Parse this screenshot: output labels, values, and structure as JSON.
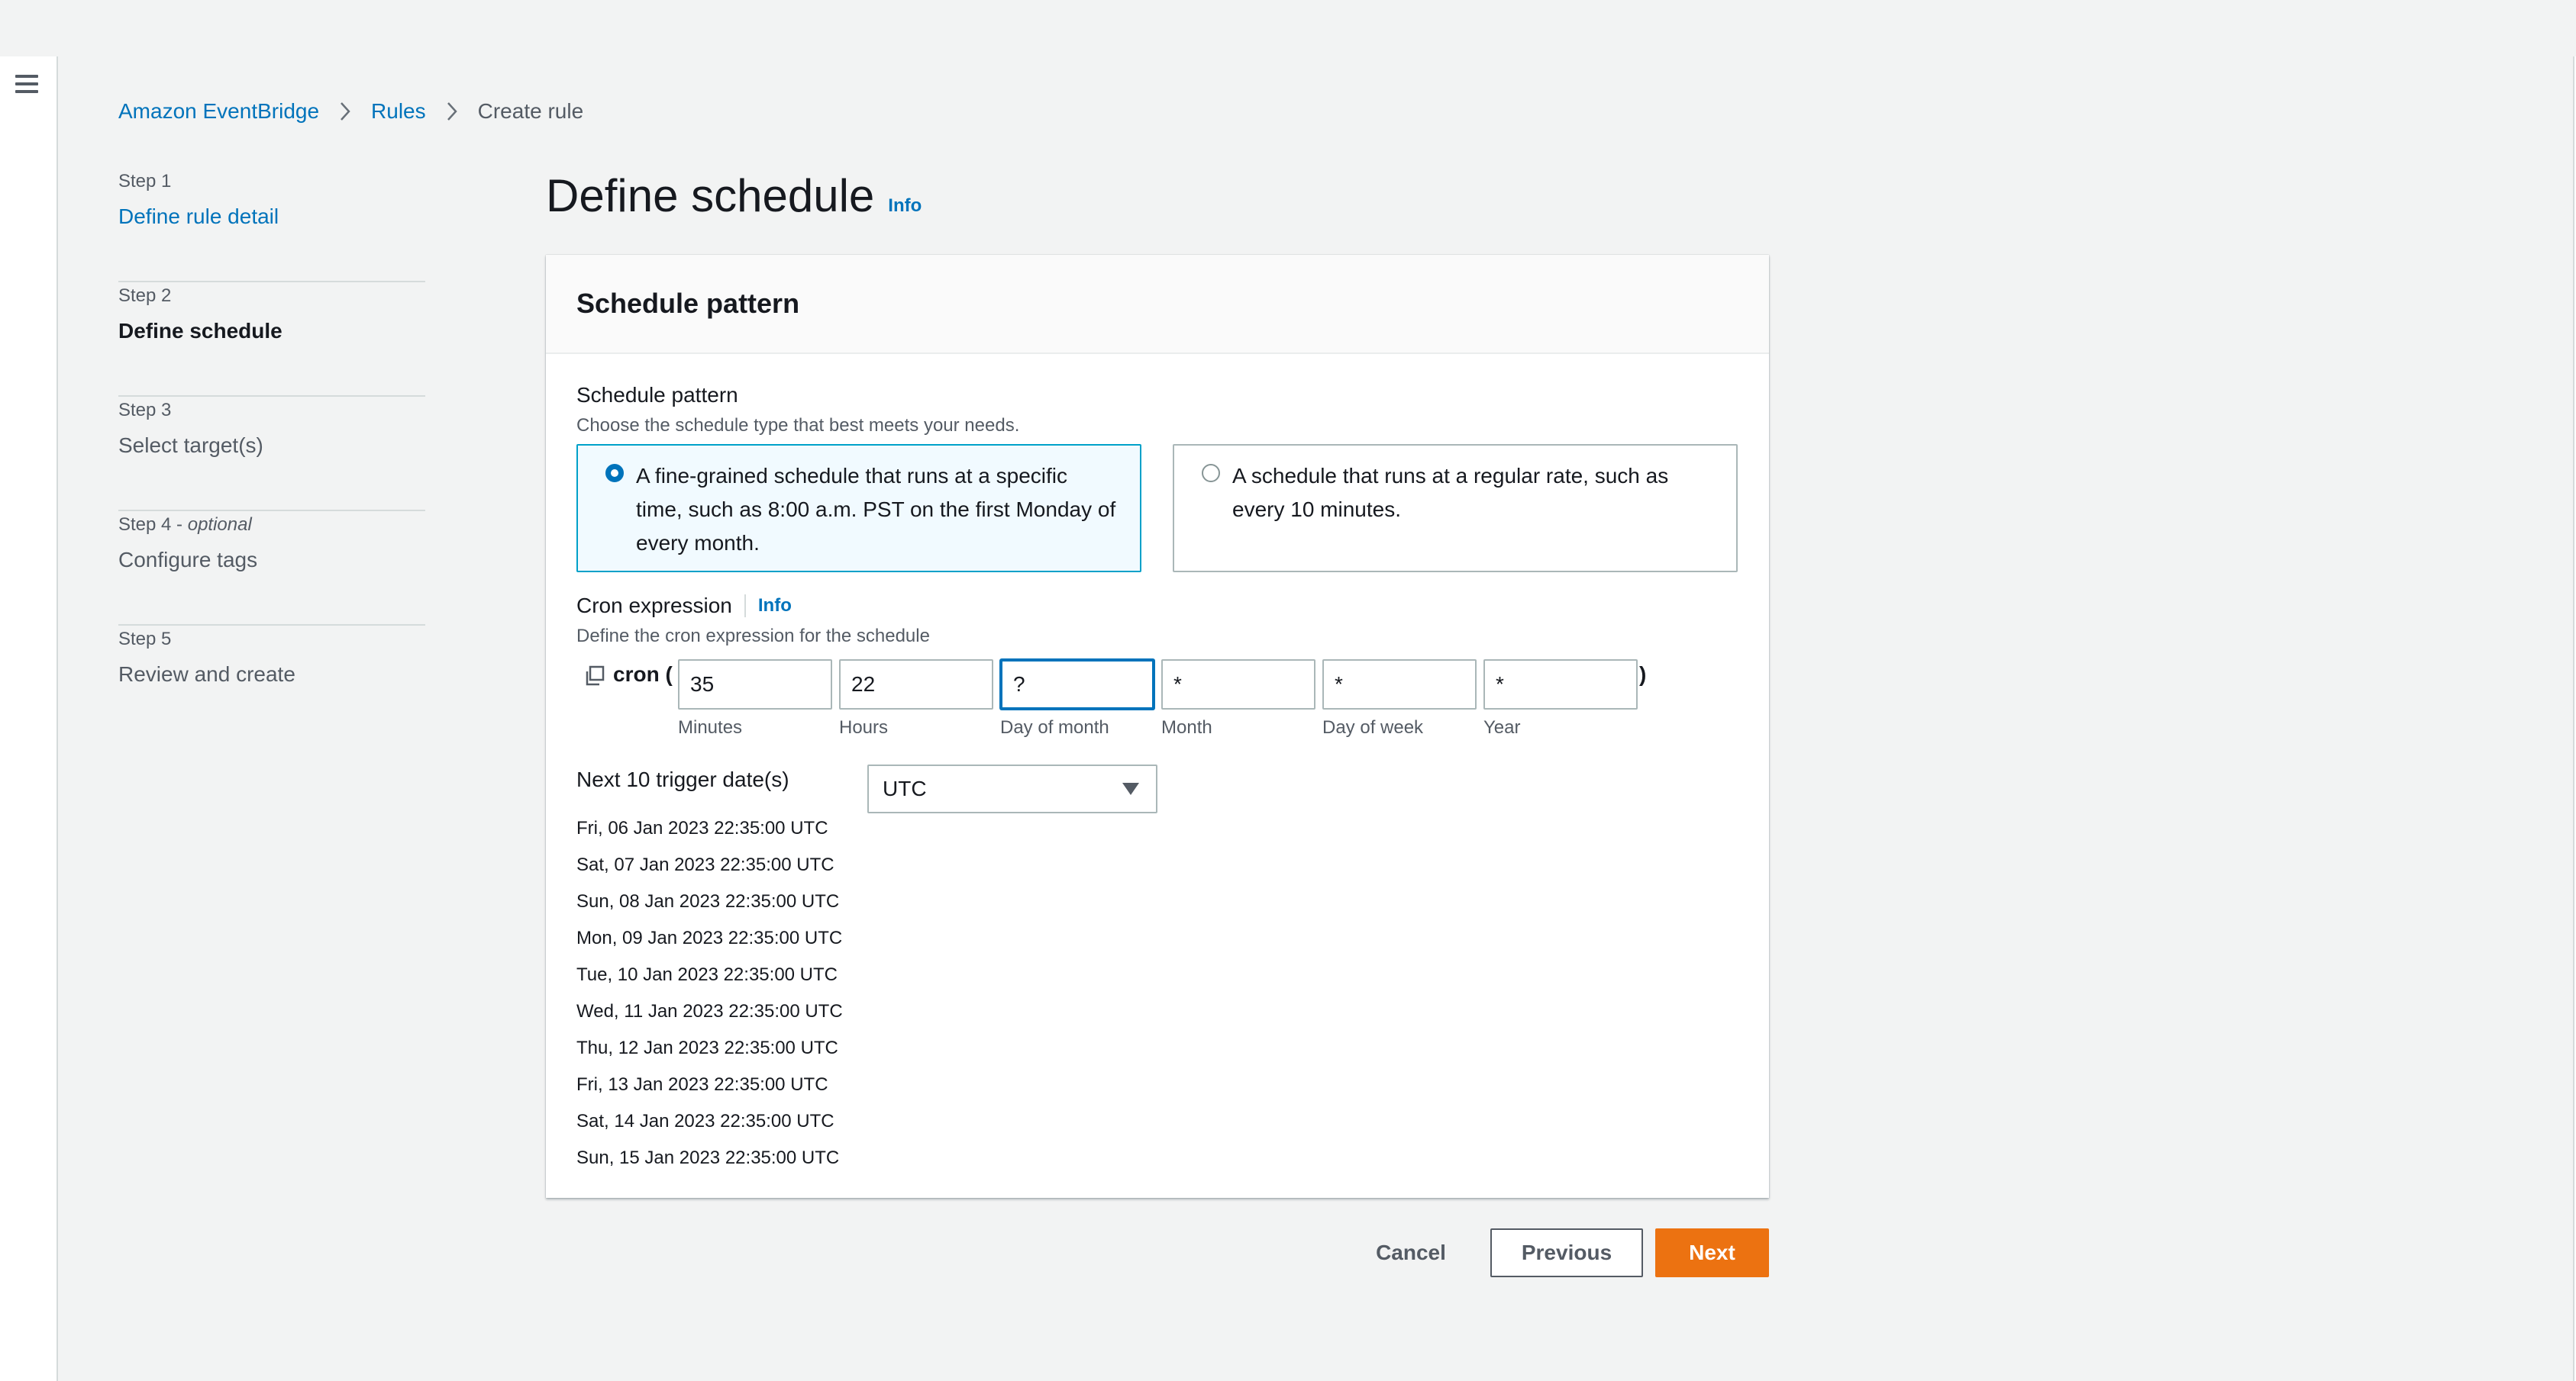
{
  "breadcrumb": {
    "items": [
      "Amazon EventBridge",
      "Rules"
    ],
    "current": "Create rule"
  },
  "steps": [
    {
      "label": "Step 1",
      "optional": "",
      "title": "Define rule detail",
      "state": "link"
    },
    {
      "label": "Step 2",
      "optional": "",
      "title": "Define schedule",
      "state": "active"
    },
    {
      "label": "Step 3",
      "optional": "",
      "title": "Select target(s)",
      "state": "disabled"
    },
    {
      "label": "Step 4 - ",
      "optional": "optional",
      "title": "Configure tags",
      "state": "disabled"
    },
    {
      "label": "Step 5",
      "optional": "",
      "title": "Review and create",
      "state": "disabled"
    }
  ],
  "page": {
    "title": "Define schedule",
    "info": "Info"
  },
  "card": {
    "header": "Schedule pattern"
  },
  "schedule_pattern": {
    "label": "Schedule pattern",
    "description": "Choose the schedule type that best meets your needs.",
    "options": [
      {
        "text": "A fine-grained schedule that runs at a specific time, such as 8:00 a.m. PST on the first Monday of every month.",
        "selected": true
      },
      {
        "text": "A schedule that runs at a regular rate, such as every 10 minutes.",
        "selected": false
      }
    ]
  },
  "cron": {
    "label": "Cron expression",
    "info": "Info",
    "description": "Define the cron expression for the schedule",
    "prefix": "cron (",
    "suffix": ")",
    "fields": [
      {
        "value": "35",
        "caption": "Minutes"
      },
      {
        "value": "22",
        "caption": "Hours"
      },
      {
        "value": "?",
        "caption": "Day of month"
      },
      {
        "value": "*",
        "caption": "Month"
      },
      {
        "value": "*",
        "caption": "Day of week"
      },
      {
        "value": "*",
        "caption": "Year"
      }
    ]
  },
  "triggers": {
    "label": "Next 10 trigger date(s)",
    "timezone": "UTC",
    "dates": [
      "Fri, 06 Jan 2023 22:35:00 UTC",
      "Sat, 07 Jan 2023 22:35:00 UTC",
      "Sun, 08 Jan 2023 22:35:00 UTC",
      "Mon, 09 Jan 2023 22:35:00 UTC",
      "Tue, 10 Jan 2023 22:35:00 UTC",
      "Wed, 11 Jan 2023 22:35:00 UTC",
      "Thu, 12 Jan 2023 22:35:00 UTC",
      "Fri, 13 Jan 2023 22:35:00 UTC",
      "Sat, 14 Jan 2023 22:35:00 UTC",
      "Sun, 15 Jan 2023 22:35:00 UTC"
    ]
  },
  "buttons": {
    "cancel": "Cancel",
    "previous": "Previous",
    "next": "Next"
  },
  "colors": {
    "link": "#0073bb",
    "primary": "#ec7211",
    "selected_border": "#00a1c9"
  }
}
